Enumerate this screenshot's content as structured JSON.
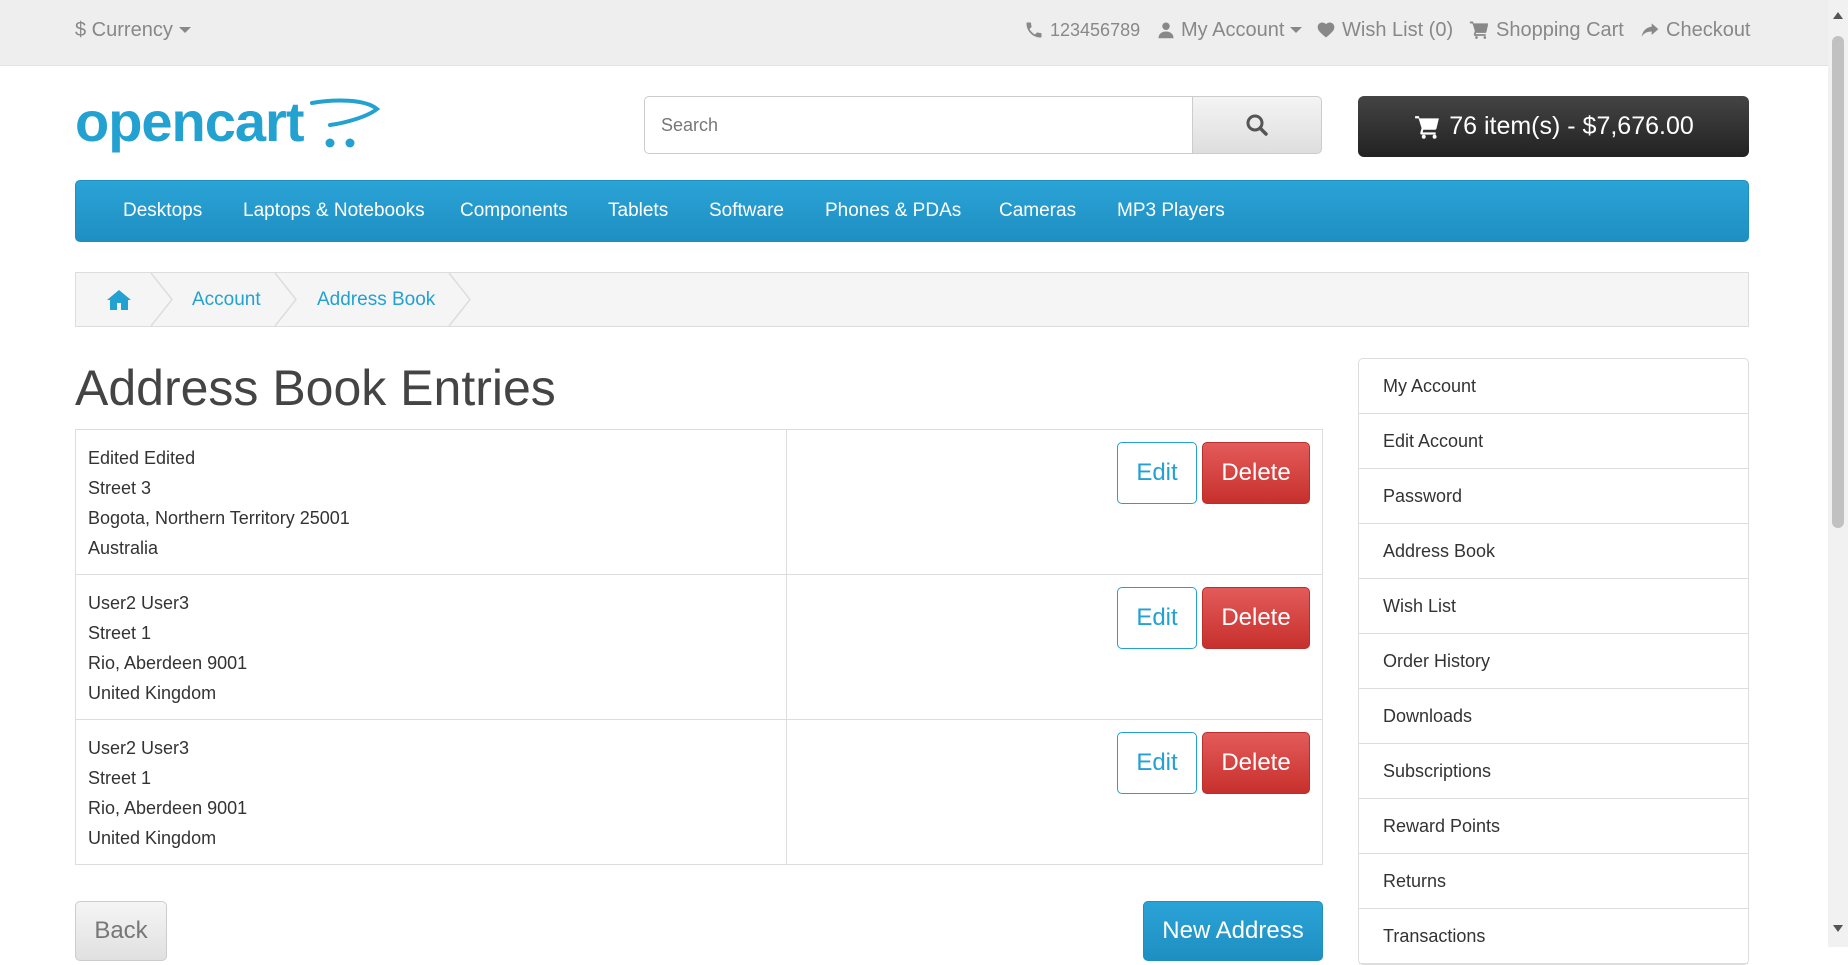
{
  "topbar": {
    "currency": "$ Currency",
    "phone": "123456789",
    "my_account": "My Account",
    "wish_list": "Wish List (0)",
    "shopping_cart": "Shopping Cart",
    "checkout": "Checkout"
  },
  "header": {
    "logo_text": "opencart",
    "search_placeholder": "Search",
    "cart_summary": "76 item(s) - $7,676.00"
  },
  "nav": {
    "items": [
      "Desktops",
      "Laptops & Notebooks",
      "Components",
      "Tablets",
      "Software",
      "Phones & PDAs",
      "Cameras",
      "MP3 Players"
    ]
  },
  "breadcrumb": {
    "items": [
      "Account",
      "Address Book"
    ]
  },
  "page": {
    "title": "Address Book Entries"
  },
  "addresses": [
    {
      "line1": "Edited Edited",
      "line2": "Street 3",
      "line3": "Bogota, Northern Territory 25001",
      "line4": "Australia"
    },
    {
      "line1": "User2 User3",
      "line2": "Street 1",
      "line3": "Rio, Aberdeen 9001",
      "line4": "United Kingdom"
    },
    {
      "line1": "User2 User3",
      "line2": "Street 1",
      "line3": "Rio, Aberdeen 9001",
      "line4": "United Kingdom"
    }
  ],
  "buttons": {
    "edit": "Edit",
    "delete": "Delete",
    "back": "Back",
    "new_address": "New Address"
  },
  "sidebar": {
    "items": [
      "My Account",
      "Edit Account",
      "Password",
      "Address Book",
      "Wish List",
      "Order History",
      "Downloads",
      "Subscriptions",
      "Reward Points",
      "Returns",
      "Transactions"
    ]
  },
  "colors": {
    "brand_blue": "#23a1d1",
    "delete_red": "#c7302c",
    "cart_dark": "#222222"
  },
  "icons": [
    "phone-icon",
    "user-icon",
    "heart-icon",
    "cart-icon",
    "share-icon",
    "search-icon",
    "home-icon"
  ]
}
